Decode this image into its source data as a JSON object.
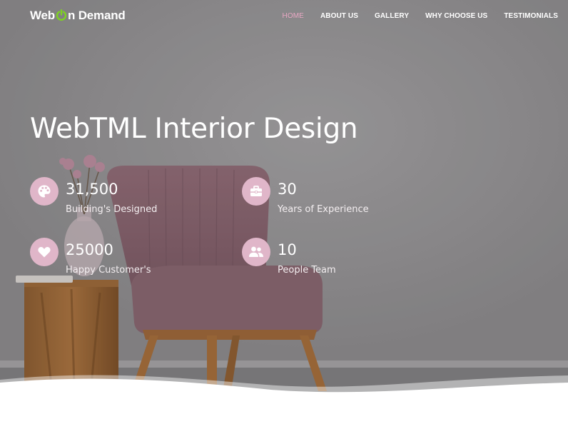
{
  "brand": {
    "name_part1": "Web",
    "name_part2": "n Demand",
    "logo_icon": "power-icon",
    "accent_color": "#7ed321"
  },
  "nav": {
    "items": [
      {
        "label": "HOME",
        "active": true
      },
      {
        "label": "ABOUT US",
        "active": false
      },
      {
        "label": "GALLERY",
        "active": false
      },
      {
        "label": "WHY CHOOSE US",
        "active": false
      },
      {
        "label": "TESTIMONIALS",
        "active": false
      }
    ],
    "active_color": "#e8a7c3"
  },
  "hero": {
    "title": "WebTML Interior Design",
    "stats": [
      {
        "value": "31,500",
        "label": "Building's Designed",
        "icon": "palette-icon"
      },
      {
        "value": "30",
        "label": "Years of Experience",
        "icon": "briefcase-icon"
      },
      {
        "value": "25000",
        "label": "Happy Customer's",
        "icon": "heart-icon"
      },
      {
        "value": "10",
        "label": "People Team",
        "icon": "users-icon"
      }
    ],
    "icon_bg_color": "#e0b6c9"
  }
}
